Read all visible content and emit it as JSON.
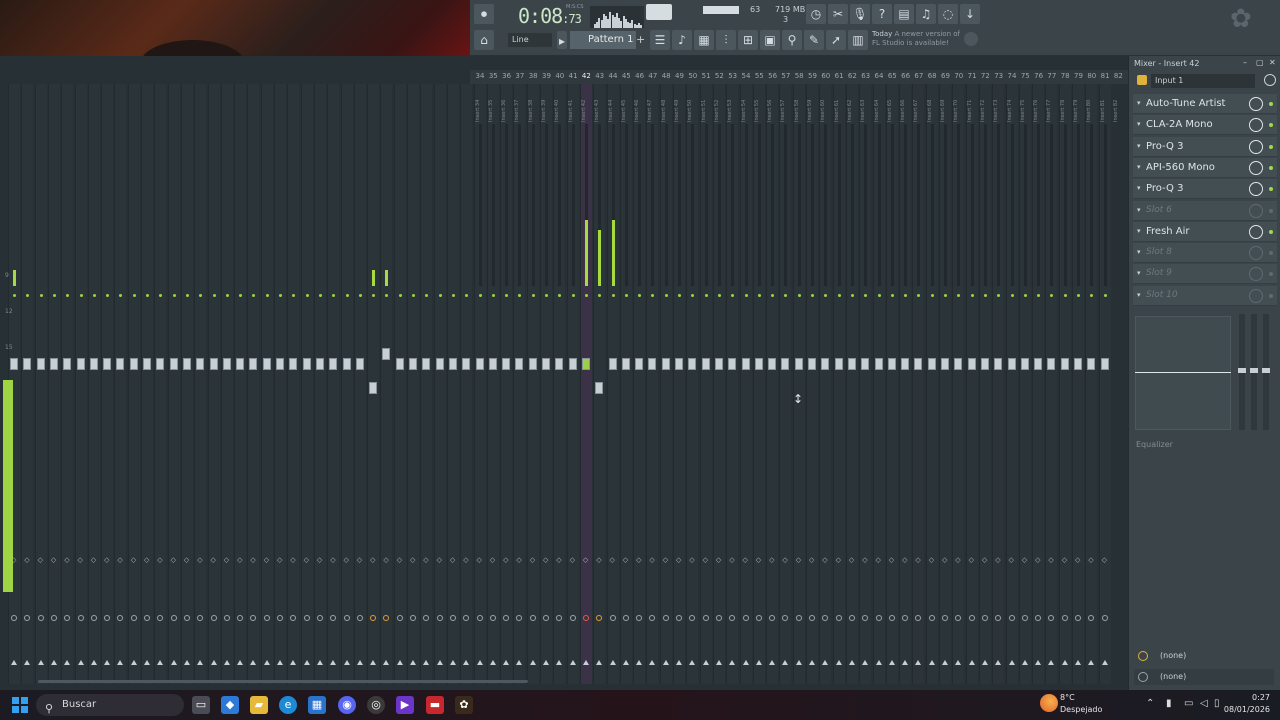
{
  "toolbar": {
    "time_value": "0:08",
    "time_frac": ":73",
    "time_unit": "M:S:CS",
    "cpu_value": "63",
    "memory": "719 MB",
    "voices": "3",
    "snap_mode": "Line",
    "pattern": "Pattern 1",
    "pattern_add": "+",
    "news_when": "Today",
    "news_text": "A newer version of FL Studio is available!"
  },
  "mixer": {
    "track_numbers": [
      "34",
      "35",
      "36",
      "37",
      "38",
      "39",
      "40",
      "41",
      "42",
      "43",
      "44",
      "45",
      "46",
      "47",
      "48",
      "49",
      "50",
      "51",
      "52",
      "53",
      "54",
      "55",
      "56",
      "57",
      "58",
      "59",
      "60",
      "61",
      "62",
      "63",
      "64",
      "65",
      "66",
      "67",
      "68",
      "69",
      "70",
      "71",
      "72",
      "73",
      "74",
      "75",
      "76",
      "77",
      "78",
      "79",
      "80",
      "81",
      "82"
    ],
    "active_track": "42",
    "insert_prefix": "Insert",
    "scale_labels": [
      "9",
      "12",
      "15",
      "18"
    ]
  },
  "insert_panel": {
    "title": "Mixer - Insert 42",
    "win_minimize": "–",
    "win_restore": "▢",
    "win_close": "✕",
    "input": "Input 1",
    "slots": [
      {
        "name": "Auto-Tune Artist",
        "empty": false
      },
      {
        "name": "CLA-2A Mono",
        "empty": false
      },
      {
        "name": "Pro-Q 3",
        "empty": false
      },
      {
        "name": "API-560 Mono",
        "empty": false
      },
      {
        "name": "Pro-Q 3",
        "empty": false
      },
      {
        "name": "Slot 6",
        "empty": true
      },
      {
        "name": "Fresh Air",
        "empty": false
      },
      {
        "name": "Slot 8",
        "empty": true
      },
      {
        "name": "Slot 9",
        "empty": true
      },
      {
        "name": "Slot 10",
        "empty": true
      }
    ],
    "eq_label": "Equalizer",
    "route_in": "(none)",
    "route_out": "(none)"
  },
  "taskbar": {
    "search_placeholder": "Buscar",
    "temperature": "8°C",
    "weather": "Despejado",
    "time": "0:27",
    "date": "08/01/2026"
  },
  "colors": {
    "accent_green": "#a7d940",
    "active_strip": "#3b3247",
    "background": "#273034"
  }
}
